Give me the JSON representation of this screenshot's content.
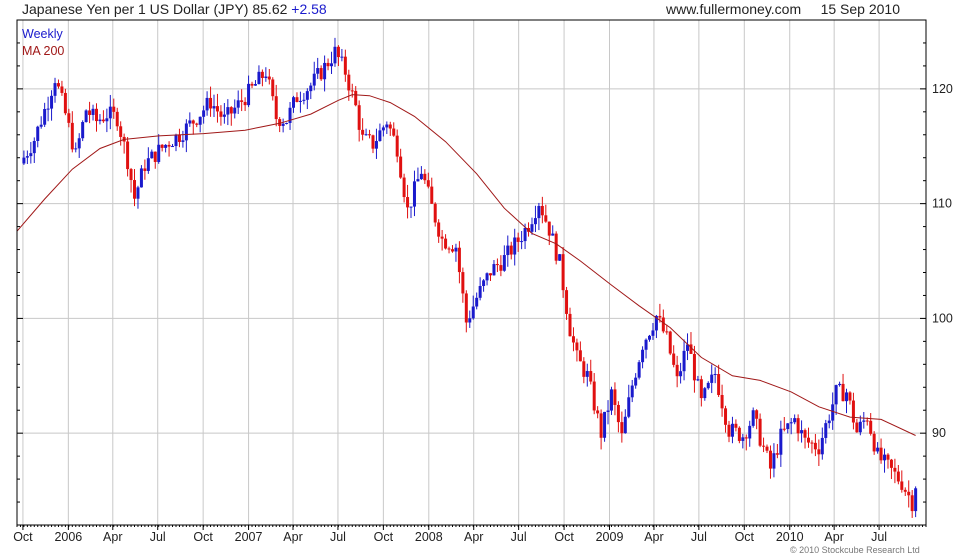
{
  "header": {
    "title": "Japanese Yen per 1 US Dollar (JPY)",
    "last": "85.62",
    "change": "+2.58",
    "site": "www.fullermoney.com",
    "date": "15 Sep 2010"
  },
  "copyright": "© 2010 Stockcube Research Ltd",
  "colors": {
    "up": "#1a1acc",
    "down": "#e01010",
    "ma": "#a01818",
    "grid": "#c8c8c8",
    "axis": "#000000"
  },
  "chart_data": {
    "type": "candlestick-line",
    "interval": "Weekly",
    "x_range": [
      "2005-09-19",
      "2010-10-04"
    ],
    "ylim": [
      82,
      126
    ],
    "y_ticks": [
      90,
      100,
      110,
      120
    ],
    "x_ticks": [
      {
        "label": "Oct",
        "date": "2005-10-01"
      },
      {
        "label": "2006",
        "date": "2006-01-01"
      },
      {
        "label": "Apr",
        "date": "2006-04-01"
      },
      {
        "label": "Jul",
        "date": "2006-07-01"
      },
      {
        "label": "Oct",
        "date": "2006-10-01"
      },
      {
        "label": "2007",
        "date": "2007-01-01"
      },
      {
        "label": "Apr",
        "date": "2007-04-01"
      },
      {
        "label": "Jul",
        "date": "2007-07-01"
      },
      {
        "label": "Oct",
        "date": "2007-10-01"
      },
      {
        "label": "2008",
        "date": "2008-01-01"
      },
      {
        "label": "Apr",
        "date": "2008-04-01"
      },
      {
        "label": "Jul",
        "date": "2008-07-01"
      },
      {
        "label": "Oct",
        "date": "2008-10-01"
      },
      {
        "label": "2009",
        "date": "2009-01-01"
      },
      {
        "label": "Apr",
        "date": "2009-04-01"
      },
      {
        "label": "Jul",
        "date": "2009-07-01"
      },
      {
        "label": "Oct",
        "date": "2009-10-01"
      },
      {
        "label": "2010",
        "date": "2010-01-01"
      },
      {
        "label": "Apr",
        "date": "2010-04-01"
      },
      {
        "label": "Jul",
        "date": "2010-07-01"
      }
    ],
    "legend": [
      {
        "label": "Weekly",
        "color": "#1a1acc"
      },
      {
        "label": "MA 200",
        "color": "#a01818"
      }
    ],
    "series": [
      {
        "name": "Weekly",
        "kind": "close",
        "points": [
          [
            "2005-09-26",
            113.5
          ],
          [
            "2005-10-24",
            115.6
          ],
          [
            "2005-11-21",
            119.0
          ],
          [
            "2005-12-05",
            121.0
          ],
          [
            "2005-12-26",
            117.8
          ],
          [
            "2006-01-16",
            114.2
          ],
          [
            "2006-02-06",
            118.2
          ],
          [
            "2006-02-27",
            117.2
          ],
          [
            "2006-03-20",
            117.8
          ],
          [
            "2006-04-10",
            117.5
          ],
          [
            "2006-05-01",
            113.8
          ],
          [
            "2006-05-15",
            110.5
          ],
          [
            "2006-06-05",
            113.4
          ],
          [
            "2006-07-03",
            114.6
          ],
          [
            "2006-07-24",
            115.4
          ],
          [
            "2006-08-14",
            116.0
          ],
          [
            "2006-09-11",
            117.2
          ],
          [
            "2006-10-16",
            118.9
          ],
          [
            "2006-11-13",
            117.3
          ],
          [
            "2006-12-11",
            118.6
          ],
          [
            "2007-01-08",
            120.0
          ],
          [
            "2007-02-05",
            121.5
          ],
          [
            "2007-02-26",
            117.5
          ],
          [
            "2007-03-19",
            117.3
          ],
          [
            "2007-04-09",
            119.3
          ],
          [
            "2007-05-07",
            120.3
          ],
          [
            "2007-06-04",
            121.9
          ],
          [
            "2007-06-25",
            123.2
          ],
          [
            "2007-07-16",
            121.5
          ],
          [
            "2007-08-06",
            118.4
          ],
          [
            "2007-08-20",
            115.6
          ],
          [
            "2007-09-10",
            115.2
          ],
          [
            "2007-10-08",
            117.2
          ],
          [
            "2007-10-29",
            114.9
          ],
          [
            "2007-11-19",
            109.4
          ],
          [
            "2007-12-17",
            112.9
          ],
          [
            "2008-01-07",
            109.7
          ],
          [
            "2008-01-28",
            106.9
          ],
          [
            "2008-02-25",
            106.3
          ],
          [
            "2008-03-17",
            99.7
          ],
          [
            "2008-04-07",
            101.8
          ],
          [
            "2008-05-05",
            104.1
          ],
          [
            "2008-06-02",
            105.2
          ],
          [
            "2008-06-30",
            106.8
          ],
          [
            "2008-07-21",
            108.2
          ],
          [
            "2008-08-11",
            110.2
          ],
          [
            "2008-09-01",
            107.8
          ],
          [
            "2008-09-22",
            104.8
          ],
          [
            "2008-10-13",
            99.1
          ],
          [
            "2008-10-27",
            96.5
          ],
          [
            "2008-11-17",
            95.0
          ],
          [
            "2008-12-15",
            90.0
          ],
          [
            "2009-01-05",
            93.4
          ],
          [
            "2009-01-26",
            89.6
          ],
          [
            "2009-02-16",
            94.2
          ],
          [
            "2009-03-09",
            97.8
          ],
          [
            "2009-04-06",
            100.2
          ],
          [
            "2009-04-27",
            98.2
          ],
          [
            "2009-05-18",
            94.5
          ],
          [
            "2009-06-08",
            97.9
          ],
          [
            "2009-07-06",
            92.6
          ],
          [
            "2009-08-03",
            95.2
          ],
          [
            "2009-08-31",
            90.3
          ],
          [
            "2009-09-28",
            89.8
          ],
          [
            "2009-10-19",
            91.4
          ],
          [
            "2009-11-23",
            86.9
          ],
          [
            "2009-12-14",
            89.7
          ],
          [
            "2010-01-11",
            91.2
          ],
          [
            "2010-02-01",
            89.3
          ],
          [
            "2010-03-01",
            88.8
          ],
          [
            "2010-04-05",
            93.5
          ],
          [
            "2010-04-26",
            93.6
          ],
          [
            "2010-05-17",
            90.1
          ],
          [
            "2010-06-07",
            91.5
          ],
          [
            "2010-06-28",
            88.0
          ],
          [
            "2010-07-26",
            86.7
          ],
          [
            "2010-08-16",
            85.7
          ],
          [
            "2010-09-06",
            84.0
          ],
          [
            "2010-09-13",
            85.6
          ]
        ]
      },
      {
        "name": "MA 200",
        "kind": "line",
        "points": [
          [
            "2005-09-19",
            107.6
          ],
          [
            "2005-11-14",
            110.4
          ],
          [
            "2006-01-09",
            113.0
          ],
          [
            "2006-03-06",
            114.8
          ],
          [
            "2006-04-24",
            115.6
          ],
          [
            "2006-07-03",
            115.9
          ],
          [
            "2006-10-02",
            116.1
          ],
          [
            "2006-12-25",
            116.4
          ],
          [
            "2007-03-05",
            117.0
          ],
          [
            "2007-05-07",
            117.8
          ],
          [
            "2007-07-02",
            119.0
          ],
          [
            "2007-07-30",
            119.5
          ],
          [
            "2007-09-03",
            119.4
          ],
          [
            "2007-10-15",
            118.8
          ],
          [
            "2007-12-03",
            117.6
          ],
          [
            "2008-02-04",
            115.4
          ],
          [
            "2008-04-07",
            112.6
          ],
          [
            "2008-06-02",
            109.6
          ],
          [
            "2008-07-28",
            107.4
          ],
          [
            "2008-09-15",
            106.5
          ],
          [
            "2008-11-03",
            105.0
          ],
          [
            "2009-01-05",
            102.9
          ],
          [
            "2009-03-02",
            101.1
          ],
          [
            "2009-05-04",
            99.2
          ],
          [
            "2009-07-06",
            96.6
          ],
          [
            "2009-09-07",
            95.0
          ],
          [
            "2009-11-02",
            94.6
          ],
          [
            "2010-01-04",
            93.6
          ],
          [
            "2010-03-01",
            92.3
          ],
          [
            "2010-05-03",
            91.4
          ],
          [
            "2010-07-05",
            91.2
          ],
          [
            "2010-09-13",
            89.8
          ]
        ]
      }
    ]
  }
}
